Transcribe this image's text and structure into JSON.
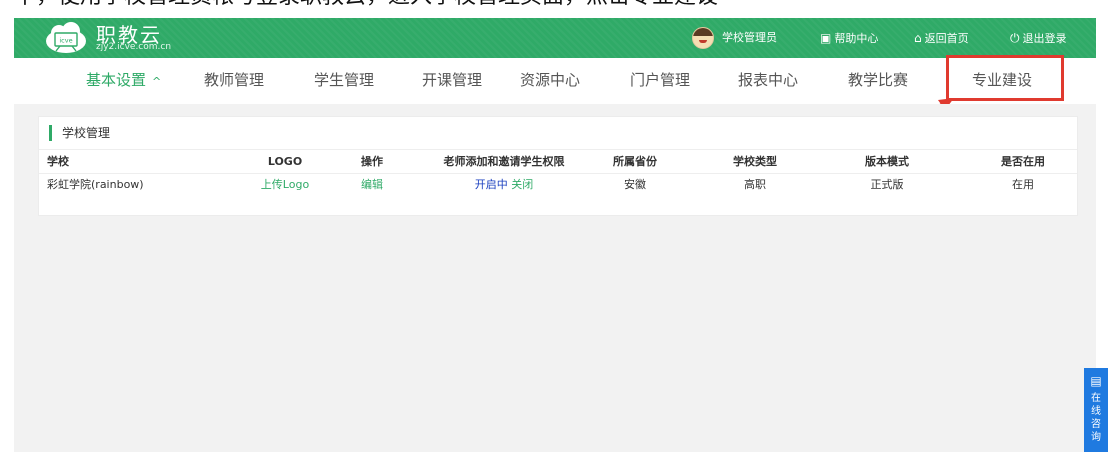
{
  "top_text": "中，使用学校管理员帐号登录职教云，进入学校管理页面，点击专业建设",
  "header": {
    "brand_name": "职教云",
    "brand_url": "zjy2.icve.com.cn",
    "logo_text": "icve",
    "user_label": "学校管理员",
    "help_label": "帮助中心",
    "home_label": "返回首页",
    "logout_label": "退出登录"
  },
  "nav": {
    "items": [
      {
        "label": "基本设置",
        "active": true
      },
      {
        "label": "教师管理"
      },
      {
        "label": "学生管理"
      },
      {
        "label": "开课管理"
      },
      {
        "label": "资源中心"
      },
      {
        "label": "门户管理"
      },
      {
        "label": "报表中心"
      },
      {
        "label": "教学比赛"
      },
      {
        "label": "专业建设"
      }
    ],
    "active_chevron": "^"
  },
  "panel": {
    "title": "学校管理",
    "columns": [
      "学校",
      "LOGO",
      "操作",
      "老师添加和邀请学生权限",
      "所属省份",
      "学校类型",
      "版本模式",
      "是否在用"
    ],
    "row": {
      "school": "彩虹学院(rainbow)",
      "logo_action": "上传Logo",
      "edit_action": "编辑",
      "perm_on": "开启中",
      "perm_off": "关闭",
      "province": "安徽",
      "type": "高职",
      "version": "正式版",
      "in_use": "在用"
    }
  },
  "side_chat": {
    "chars": [
      "在",
      "线",
      "咨",
      "询"
    ]
  },
  "colors": {
    "brand_green": "#2faa67",
    "highlight_red": "#e03a2f",
    "chat_blue": "#1f7ae0"
  }
}
